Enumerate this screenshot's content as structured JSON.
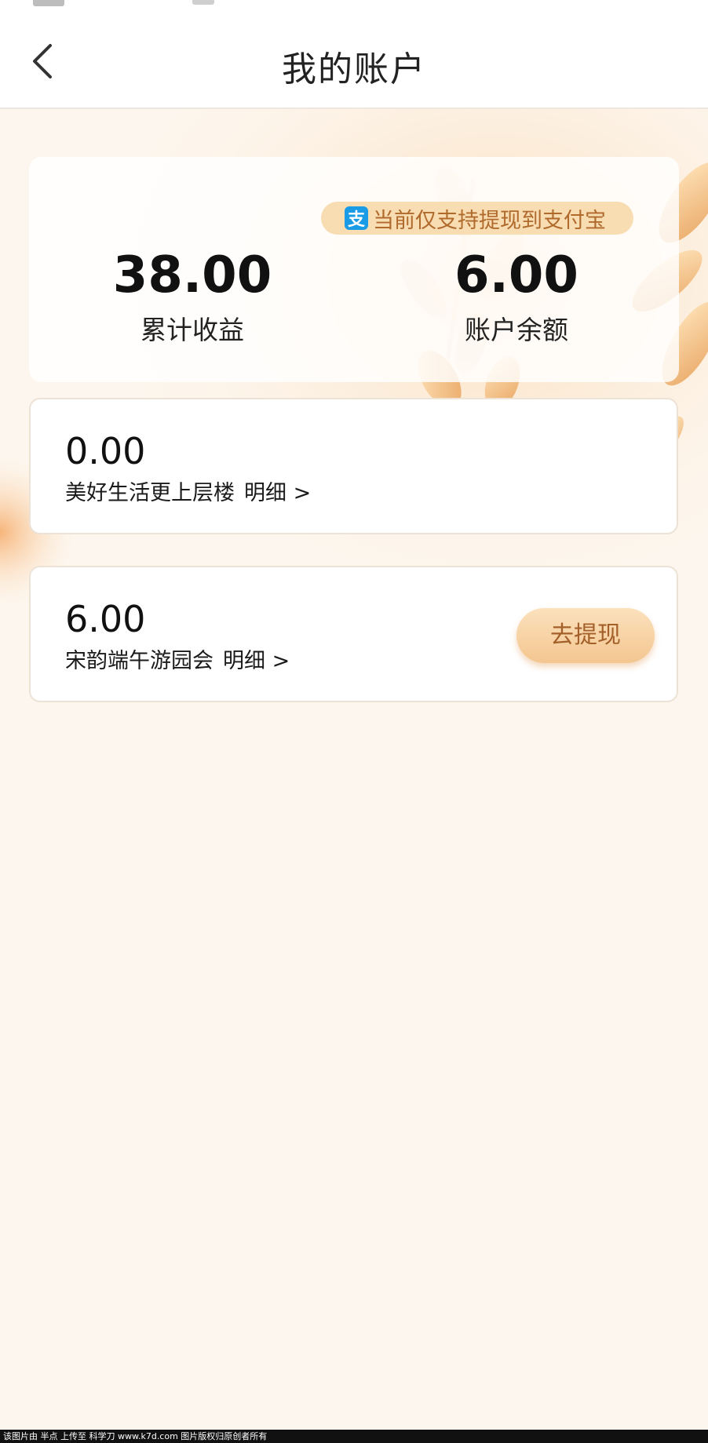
{
  "header": {
    "title": "我的账户"
  },
  "summary": {
    "alipay_tip": "当前仅支持提现到支付宝",
    "alipay_icon_glyph": "支",
    "total_earnings_value": "38.00",
    "total_earnings_label": "累计收益",
    "balance_value": "6.00",
    "balance_label": "账户余额"
  },
  "entries": [
    {
      "amount": "0.00",
      "name": "美好生活更上层楼",
      "detail_label": "明细 >"
    },
    {
      "amount": "6.00",
      "name": "宋韵端午游园会",
      "detail_label": "明细 >",
      "withdraw_label": "去提现"
    }
  ],
  "watermark": "该图片由 半点 上传至 科学刀 www.k7d.com 图片版权归原创者所有",
  "colors": {
    "page_background": "#fdf6ee",
    "accent_text": "#b06a2c",
    "button_gradient_top": "#fbe1bd",
    "button_gradient_bottom": "#f4c690",
    "alipay_blue": "#1a9be6"
  }
}
